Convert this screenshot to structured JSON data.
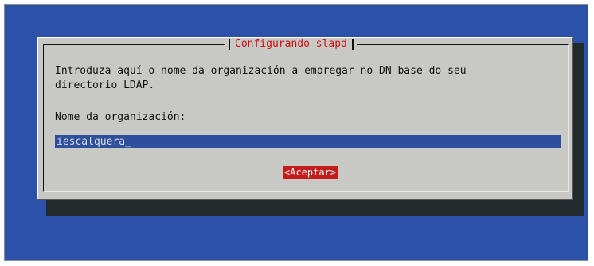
{
  "dialog": {
    "title": "Configurando slapd",
    "message": "Introduza aquí o nome da organización a empregar no DN base do seu\ndirectorio LDAP.",
    "field_label": "Nome da organización:",
    "input_value": "iescalquera",
    "ok_label": "<Aceptar>"
  },
  "colors": {
    "screen_background": "#2b52a8",
    "dialog_background": "#c8c8c4",
    "title_color": "#cc1111",
    "input_background": "#2d4f9e",
    "button_background": "#c41b1b"
  }
}
